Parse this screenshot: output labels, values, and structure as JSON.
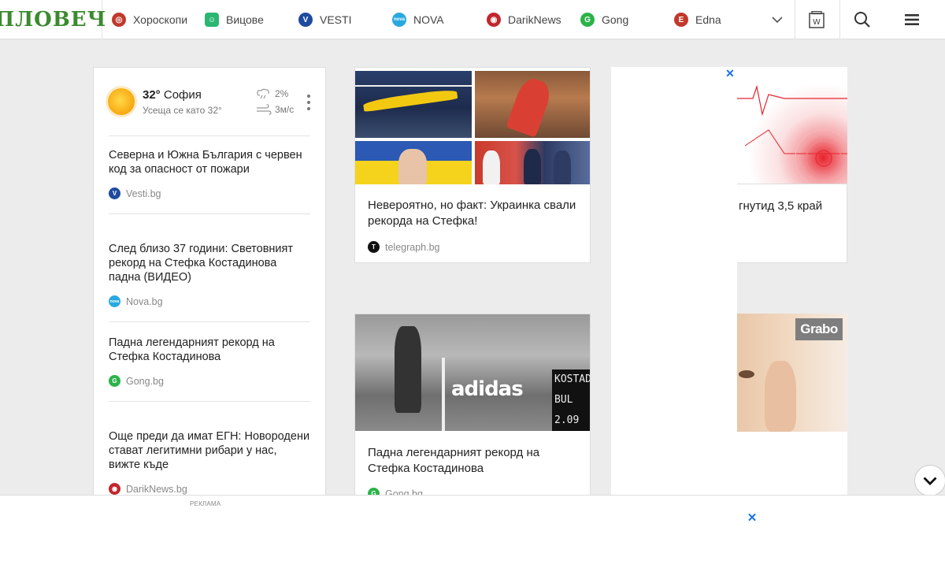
{
  "header": {
    "logo": "ПЛОВЕЧ",
    "nav": [
      {
        "label": "Хороскопи",
        "icon": "horoscope-icon",
        "color": "#c0392b",
        "glyph": "◎"
      },
      {
        "label": "Вицове",
        "icon": "jokes-icon",
        "color": "#2bb673",
        "glyph": "☺"
      },
      {
        "label": "VESTI",
        "icon": "vesti-icon",
        "color": "#1f4aa0",
        "glyph": "V"
      },
      {
        "label": "NOVA",
        "icon": "nova-icon",
        "color": "#29a8e0",
        "glyph": "nova"
      },
      {
        "label": "DarikNews",
        "icon": "dariknews-icon",
        "color": "#c1272d",
        "glyph": "◉"
      },
      {
        "label": "Gong",
        "icon": "gong-icon",
        "color": "#2bb34a",
        "glyph": "G"
      },
      {
        "label": "Edna",
        "icon": "edna-icon",
        "color": "#c0392b",
        "glyph": "E"
      }
    ]
  },
  "weather": {
    "temp": "32°",
    "city": "София",
    "feels_like": "Усеща се като 32°",
    "rain": "2%",
    "wind": "3м/с"
  },
  "news": [
    {
      "title": "Северна и Южна България с червен код за опасност от пожари",
      "source": "Vesti.bg",
      "icon_color": "#1f4aa0",
      "glyph": "V"
    },
    {
      "title": "След близо 37 години: Световният рекорд на Стефка Костадинова падна (ВИДЕО)",
      "source": "Nova.bg",
      "icon_color": "#29a8e0",
      "glyph": "nova"
    },
    {
      "title": "Падна легендарният рекорд на Стефка Костадинова",
      "source": "Gong.bg",
      "icon_color": "#2bb34a",
      "glyph": "G"
    },
    {
      "title": "Още преди да имат ЕГН: Новородени стават легитимни рибари у нас, вижте къде",
      "source": "DarikNews.bg",
      "icon_color": "#c1272d",
      "glyph": "◉"
    }
  ],
  "cards": [
    {
      "title": "Невероятно, но факт: Украинка свали рекорда на Стефка!",
      "source": "telegraph.bg",
      "icon_color": "#111111",
      "glyph": "T"
    },
    {
      "title": "Падна легендарният рекорд на Стефка Костадинова",
      "source": "Gong.bg",
      "icon_color": "#2bb34a",
      "glyph": "G"
    },
    {
      "title": "гнутид 3,5 край"
    }
  ],
  "photo": {
    "banner": "adidas",
    "board": "KOSTAD BUL 2.09",
    "grabo": "Grabo"
  },
  "ads": {
    "label": "Реклама",
    "close": "✕"
  }
}
